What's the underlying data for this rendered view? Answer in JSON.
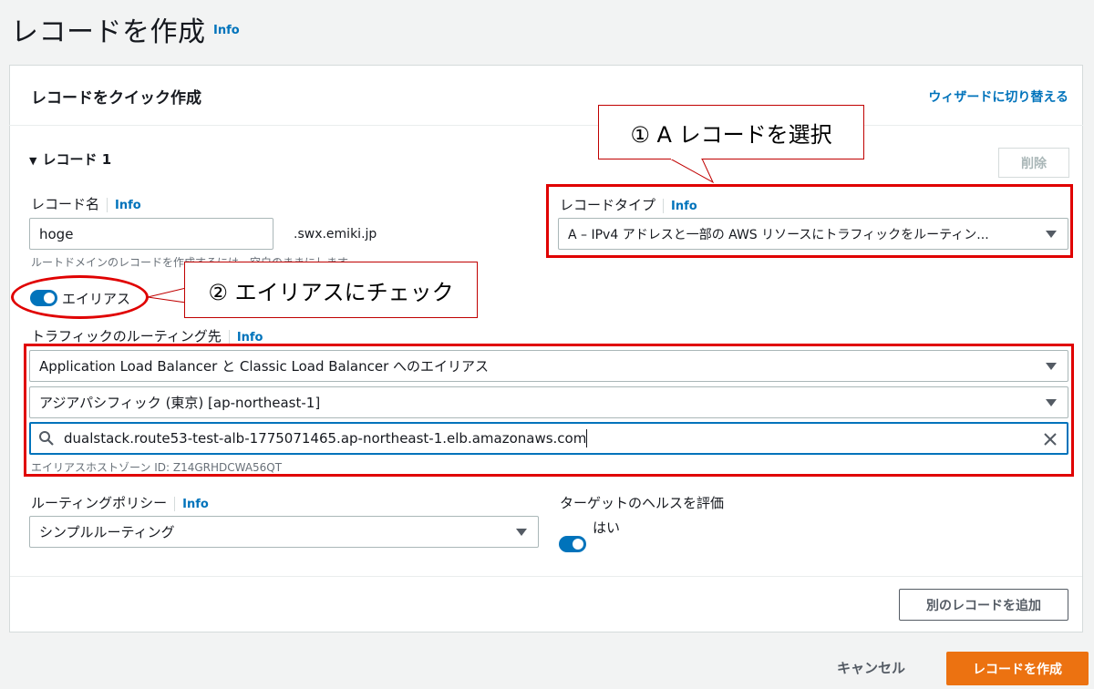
{
  "page": {
    "title": "レコードを作成",
    "info": "Info"
  },
  "panel": {
    "title": "レコードをクイック作成",
    "wizard_link": "ウィザードに切り替える"
  },
  "record": {
    "section_label": "レコード 1",
    "delete_label": "削除",
    "name_label": "レコード名",
    "name_info": "Info",
    "name_value": "hoge",
    "domain_suffix": ".swx.emiki.jp",
    "name_hint": "ルートドメインのレコードを作成するには、空白のままにします",
    "type_label": "レコードタイプ",
    "type_info": "Info",
    "type_value": "A – IPv4 アドレスと一部の AWS リソースにトラフィックをルーティン...",
    "alias_label": "エイリアス",
    "routing_target_label": "トラフィックのルーティング先",
    "routing_target_info": "Info",
    "endpoint_value": "Application Load Balancer と Classic Load Balancer へのエイリアス",
    "region_value": "アジアパシフィック (東京) [ap-northeast-1]",
    "lb_search_value": "dualstack.route53-test-alb-1775071465.ap-northeast-1.elb.amazonaws.com",
    "alias_zone_hint": "エイリアスホストゾーン ID: Z14GRHDCWA56QT",
    "policy_label": "ルーティングポリシー",
    "policy_info": "Info",
    "policy_value": "シンプルルーティング",
    "health_label": "ターゲットのヘルスを評価",
    "health_value": "はい"
  },
  "annotations": {
    "callout_1": "① A レコードを選択",
    "callout_2": "② エイリアスにチェック"
  },
  "footer": {
    "add_record": "別のレコードを追加",
    "cancel": "キャンセル",
    "create": "レコードを作成"
  },
  "colors": {
    "accent": "#0073bb",
    "primary_button": "#ec7211",
    "annotation_red": "#e00000"
  }
}
